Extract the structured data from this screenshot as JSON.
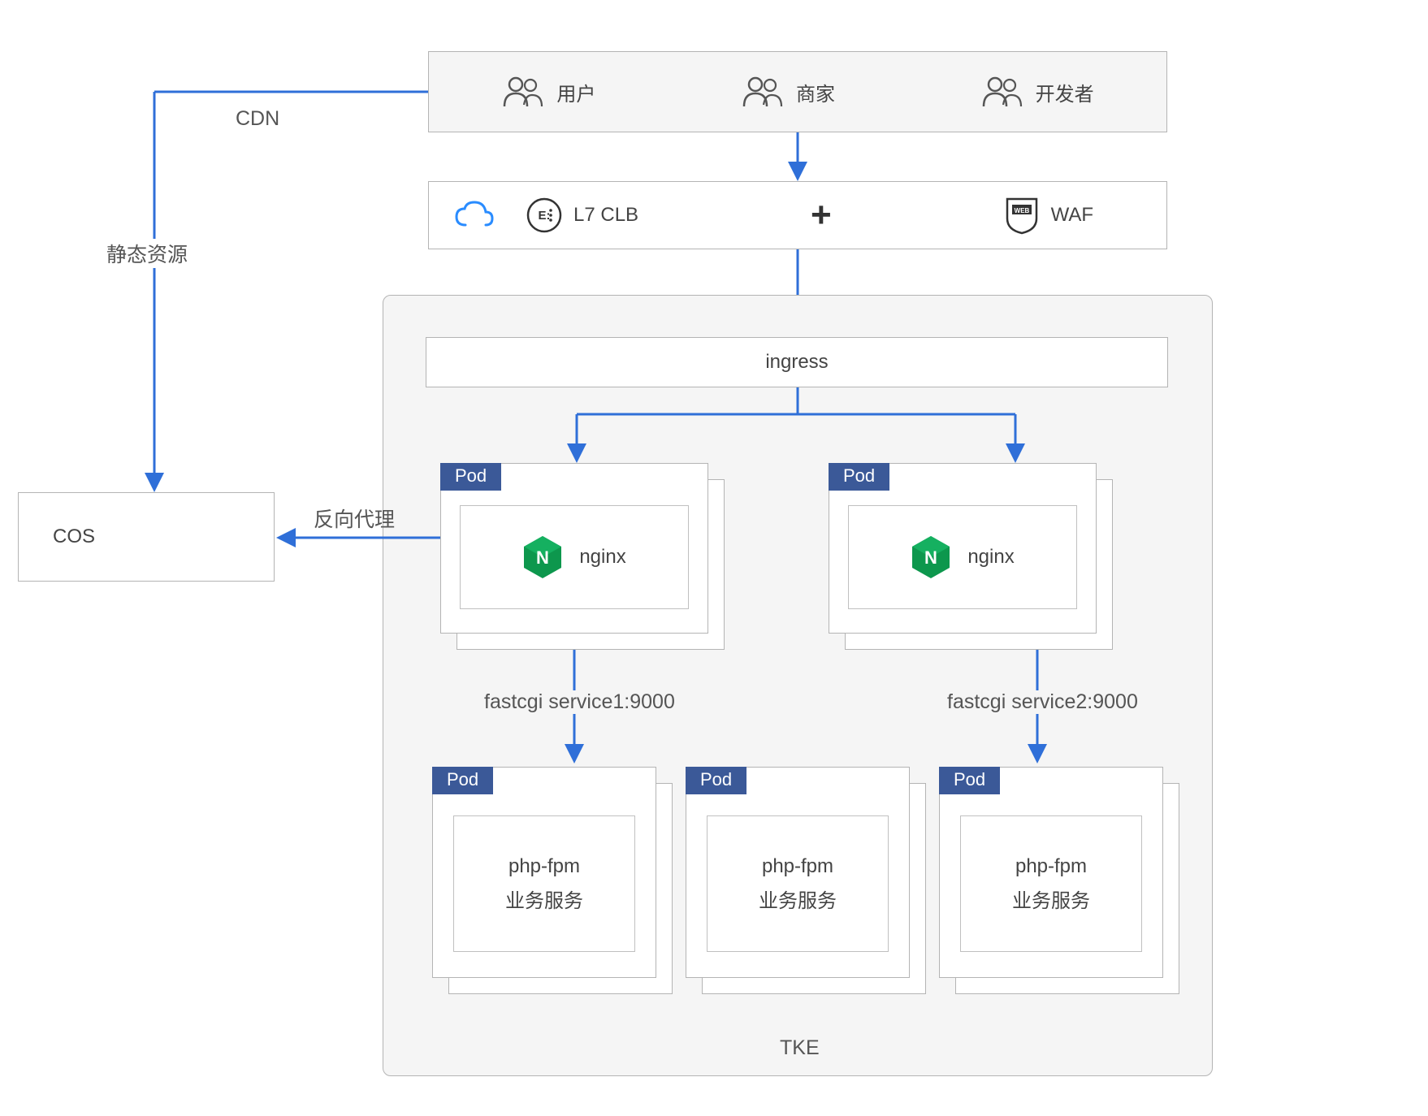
{
  "actors": {
    "user": "用户",
    "merchant": "商家",
    "developer": "开发者"
  },
  "clb": {
    "label": "L7 CLB",
    "plus": "+",
    "waf": "WAF"
  },
  "labels": {
    "cdn": "CDN",
    "static": "静态资源",
    "reverse_proxy": "反向代理",
    "ingress": "ingress",
    "tke": "TKE",
    "cos": "COS",
    "fastcgi1": "fastcgi service1:9000",
    "fastcgi2": "fastcgi service2:9000"
  },
  "pod": {
    "tab": "Pod"
  },
  "nginx": {
    "label": "nginx"
  },
  "phpfpm": {
    "line1": "php-fpm",
    "line2": "业务服务"
  },
  "colors": {
    "arrow": "#2f6fd8",
    "pod_tab": "#3b5998"
  }
}
